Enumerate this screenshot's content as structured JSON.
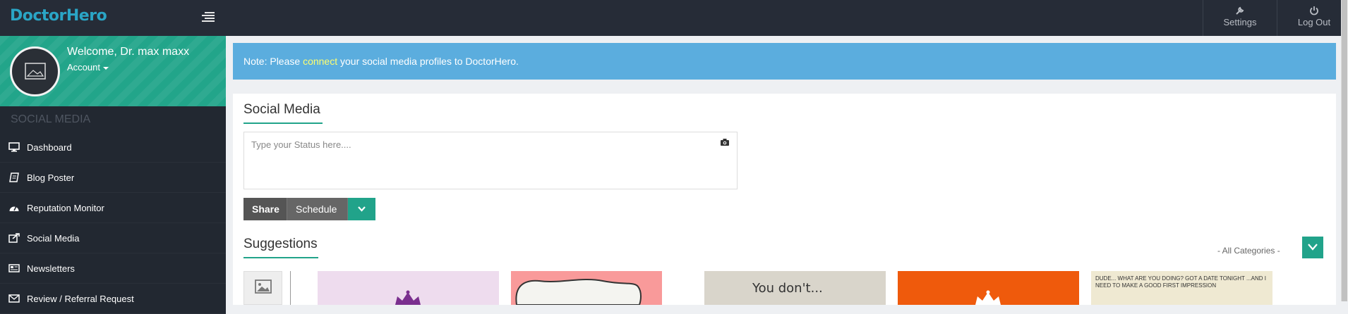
{
  "brand": {
    "logo": "DoctorHero"
  },
  "topbar": {
    "settings_label": "Settings",
    "logout_label": "Log Out"
  },
  "profile": {
    "welcome": "Welcome, Dr. max maxx",
    "account_label": "Account"
  },
  "sidebar": {
    "section_title": "SOCIAL MEDIA",
    "items": [
      {
        "label": "Dashboard",
        "icon": "monitor-icon"
      },
      {
        "label": "Blog Poster",
        "icon": "book-icon"
      },
      {
        "label": "Reputation Monitor",
        "icon": "dashboard-gauge-icon"
      },
      {
        "label": "Social Media",
        "icon": "share-icon"
      },
      {
        "label": "Newsletters",
        "icon": "newspaper-icon"
      },
      {
        "label": "Review / Referral Request",
        "icon": "envelope-icon"
      }
    ]
  },
  "notice": {
    "prefix": "Note: Please ",
    "link": "connect",
    "suffix": " your social media profiles to DoctorHero."
  },
  "social_media": {
    "title": "Social Media",
    "status_placeholder": "Type your Status here....",
    "share_label": "Share",
    "schedule_label": "Schedule"
  },
  "suggestions": {
    "title": "Suggestions",
    "category_filter": "- All Categories -",
    "thumbnails": [
      {
        "name": "suggestion-thumb-1",
        "caption": ""
      },
      {
        "name": "suggestion-thumb-2",
        "caption": ""
      },
      {
        "name": "suggestion-thumb-3",
        "caption": "You don't..."
      },
      {
        "name": "suggestion-thumb-4",
        "caption": ""
      },
      {
        "name": "suggestion-thumb-5",
        "caption": "DUDE... WHAT ARE YOU DOING?   GOT A DATE TONIGHT ...AND I NEED TO MAKE A GOOD FIRST IMPRESSION"
      }
    ]
  },
  "colors": {
    "topbar": "#262c37",
    "sidebar": "#1e242b",
    "accent_green": "#21a38a",
    "notice_blue": "#5badde",
    "link_yellow": "#ffff70",
    "logo_blue": "#2aa5c5"
  }
}
